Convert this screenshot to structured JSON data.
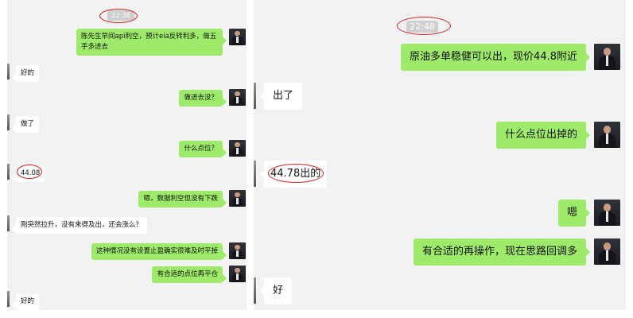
{
  "left_panel": {
    "timestamp": "22:38",
    "messages": [
      {
        "side": "out",
        "text": "陈先生早间api利空，预计eia反转利多，做五手多进去"
      },
      {
        "side": "in",
        "text": "好的"
      },
      {
        "side": "out",
        "text": "做进去没？"
      },
      {
        "side": "in",
        "text": "做了"
      },
      {
        "side": "out",
        "text": "什么点位？"
      },
      {
        "side": "in",
        "text": "44.08"
      },
      {
        "side": "out",
        "text": "嗯，数据利空但没有下跌"
      },
      {
        "side": "in",
        "text": "刚突然拉升，没有来得及出，还会涨么？"
      },
      {
        "side": "out",
        "text": "这种情况没有设置止盈确实很难及时平掉"
      },
      {
        "side": "out",
        "text": "有合适的点位再平仓"
      },
      {
        "side": "in",
        "text": "好的"
      }
    ]
  },
  "right_panel": {
    "timestamp": "22:48",
    "messages": [
      {
        "side": "out",
        "text": "原油多单稳健可以出，现价44.8附近"
      },
      {
        "side": "in",
        "text": "出了"
      },
      {
        "side": "out",
        "text": "什么点位出掉的"
      },
      {
        "side": "in",
        "text": "44.78出的"
      },
      {
        "side": "out",
        "text": "嗯"
      },
      {
        "side": "out",
        "text": "有合适的再操作，现在思路回调多"
      },
      {
        "side": "in",
        "text": "好"
      }
    ]
  },
  "colors": {
    "outgoing_bubble": "#9eea6a",
    "incoming_bubble": "#ffffff",
    "chat_background": "#f2f2f2",
    "annotation_circle": "#d81e1e"
  },
  "icons": {
    "sender_avatar": "avatar-businessman-icon",
    "contact_avatar": "avatar-contact-icon"
  }
}
